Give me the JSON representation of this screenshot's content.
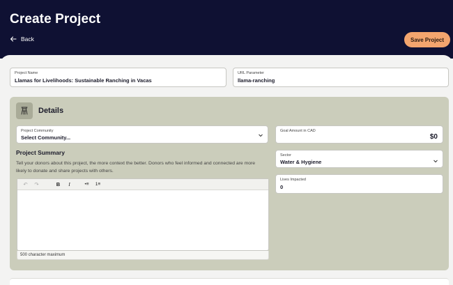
{
  "header": {
    "title": "Create Project",
    "back_label": "Back",
    "save_label": "Save Project"
  },
  "project_name": {
    "label": "Project Name",
    "value": "Llamas for Livelihoods: Sustainable Ranching in Vacas"
  },
  "url_parameter": {
    "label": "URL Parameter",
    "value": "llama-ranching"
  },
  "details": {
    "title": "Details",
    "community": {
      "label": "Project Community",
      "value": "Select Community..."
    },
    "summary": {
      "title": "Project Summary",
      "description": "Tell your donors about this project, the more context the better. Donors who feel informed and connected are more likely to donate and share projects with others.",
      "char_limit": "500 character maximum"
    },
    "editor_toolbar": {
      "undo": "↶",
      "redo": "↷",
      "bold": "B",
      "italic": "I",
      "bullet_list": "•≡",
      "numbered_list": "1≡"
    },
    "goal": {
      "label": "Goal Amount in CAD",
      "value": "$0"
    },
    "sector": {
      "label": "Sector",
      "value": "Water & Hygiene"
    },
    "lives": {
      "label": "Lives Impacted",
      "value": "0"
    }
  },
  "colors": {
    "header_bg": "#0f1133",
    "save_button": "#f3a56e",
    "details_panel": "#cbcdbb"
  }
}
